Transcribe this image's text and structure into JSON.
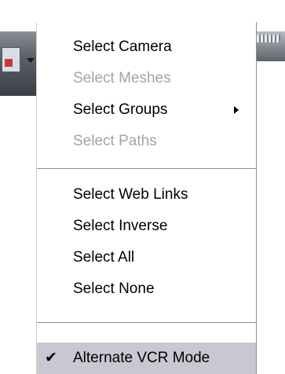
{
  "menu": {
    "items": [
      {
        "label": "Select Camera",
        "enabled": true
      },
      {
        "label": "Select Meshes",
        "enabled": false
      },
      {
        "label": "Select Groups",
        "enabled": true,
        "submenu": true
      },
      {
        "label": "Select Paths",
        "enabled": false
      }
    ],
    "group2": [
      {
        "label": "Select Web Links",
        "enabled": true
      },
      {
        "label": "Select Inverse",
        "enabled": true
      },
      {
        "label": "Select All",
        "enabled": true
      },
      {
        "label": "Select None",
        "enabled": true
      }
    ],
    "group3": [
      {
        "label": "Alternate VCR Mode",
        "enabled": true,
        "checked": true,
        "highlighted": true
      }
    ],
    "icons": {
      "submenu": "triangle-right-icon",
      "check": "checkmark-icon"
    },
    "colors": {
      "disabled_text": "#a3a3a3",
      "highlight": "#c8c8d2"
    }
  }
}
